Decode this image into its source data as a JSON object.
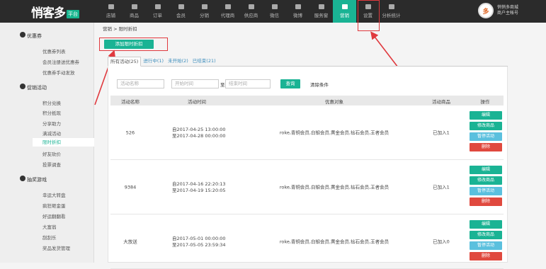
{
  "logo": {
    "main": "悄客多",
    "tag": "平台"
  },
  "nav": [
    "店铺",
    "商品",
    "订单",
    "会员",
    "分销",
    "代理商",
    "供应商",
    "微信",
    "微博",
    "服务窗",
    "营销",
    "设置",
    "分析统计"
  ],
  "nav_active": "营销",
  "user": {
    "avatar": "多",
    "line1": "悄悄多商城",
    "line2": "商户主帐号"
  },
  "sidebar": {
    "group1": {
      "title": "优惠券",
      "items": [
        "优惠券列表",
        "会员注册送优惠券",
        "优惠券手动发放"
      ]
    },
    "group2": {
      "title": "促销活动",
      "items": [
        "积分兑换",
        "积分抵现",
        "分享助力",
        "满减活动",
        "限时折扣",
        "好友砍价",
        "投票调查"
      ]
    },
    "group3": {
      "title": "抽奖游戏",
      "items": [
        "幸运大转盘",
        "疯狂砸金蛋",
        "好运翻翻看",
        "大富翁",
        "刮刮乐",
        "奖品发货管理"
      ]
    }
  },
  "breadcrumb": "营销 > 限时折扣",
  "add_button": "添加限时折扣",
  "tabs": [
    "所有活动(25)",
    "进行中(1)",
    "未开始(2)",
    "已结束(21)"
  ],
  "filter": {
    "name_placeholder": "活动名称",
    "start_placeholder": "开始时间",
    "to": "至",
    "end_placeholder": "结束时间",
    "search": "查询",
    "clear": "清除条件"
  },
  "table": {
    "headers": [
      "活动名称",
      "活动时间",
      "优惠对象",
      "活动商品",
      "操作"
    ],
    "rows": [
      {
        "name": "526",
        "start": "自2017-04-25 13:00:00",
        "end": "至2017-04-28 00:00:00",
        "target": "roke,青铜会员,白银会员,黄金会员,钻石会员,王者会员",
        "goods": "已加入1"
      },
      {
        "name": "9384",
        "start": "自2017-04-16 22:20:13",
        "end": "至2017-04-19 15:20:05",
        "target": "roke,青铜会员,白银会员,黄金会员,钻石会员,王者会员",
        "goods": "已加入1"
      },
      {
        "name": "大放送",
        "start": "自2017-05-01 00:00:00",
        "end": "至2017-05-05 23:59:34",
        "target": "roke,青铜会员,白银会员,黄金会员,钻石会员,王者会员",
        "goods": "已加入0"
      }
    ],
    "ops": {
      "edit": "编辑",
      "goods": "修改商品",
      "pause": "暂停活动",
      "delete": "删除"
    }
  },
  "colors": {
    "accent": "#1ab394",
    "highlight": "#e0393e",
    "topbar": "#2b2b2b"
  }
}
